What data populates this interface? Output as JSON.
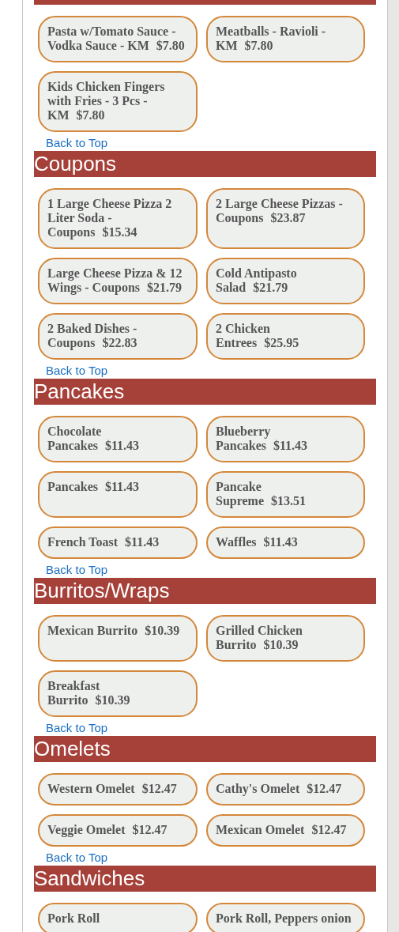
{
  "sections": [
    {
      "items": [
        {
          "name": "Pasta w/Tomato Sauce - Vodka Sauce - KM",
          "price": "$7.80"
        },
        {
          "name": "Meatballs - Ravioli - KM",
          "price": "$7.80"
        },
        {
          "name": "Kids Chicken Fingers with Fries - 3 Pcs - KM",
          "price": "$7.80"
        }
      ],
      "back_link": "Back to Top"
    },
    {
      "title": "Coupons",
      "items": [
        {
          "name": "1 Large Cheese Pizza 2 Liter Soda - Coupons",
          "price": "$15.34"
        },
        {
          "name": "2 Large Cheese Pizzas - Coupons",
          "price": "$23.87"
        },
        {
          "name": "Large Cheese Pizza & 12 Wings - Coupons",
          "price": "$21.79"
        },
        {
          "name": "Cold Antipasto Salad",
          "price": "$21.79"
        },
        {
          "name": "2 Baked Dishes - Coupons",
          "price": "$22.83"
        },
        {
          "name": "2 Chicken Entrees",
          "price": "$25.95"
        }
      ],
      "back_link": "Back to Top"
    },
    {
      "title": "Pancakes",
      "items": [
        {
          "name": "Chocolate Pancakes",
          "price": "$11.43"
        },
        {
          "name": "Blueberry Pancakes",
          "price": "$11.43"
        },
        {
          "name": "Pancakes",
          "price": "$11.43"
        },
        {
          "name": "Pancake Supreme",
          "price": "$13.51"
        },
        {
          "name": "French Toast",
          "price": "$11.43"
        },
        {
          "name": "Waffles",
          "price": "$11.43"
        }
      ],
      "back_link": "Back to Top"
    },
    {
      "title": "Burritos/Wraps",
      "items": [
        {
          "name": "Mexican Burrito",
          "price": "$10.39"
        },
        {
          "name": "Grilled Chicken Burrito",
          "price": "$10.39"
        },
        {
          "name": "Breakfast Burrito",
          "price": "$10.39"
        }
      ],
      "back_link": "Back to Top"
    },
    {
      "title": "Omelets",
      "items": [
        {
          "name": "Western Omelet",
          "price": "$12.47"
        },
        {
          "name": "Cathy's Omelet",
          "price": "$12.47"
        },
        {
          "name": "Veggie Omelet",
          "price": "$12.47"
        },
        {
          "name": "Mexican Omelet",
          "price": "$12.47"
        }
      ],
      "back_link": "Back to Top"
    },
    {
      "title": "Sandwiches",
      "items": [
        {
          "name": "Pork Roll"
        },
        {
          "name": "Pork Roll, Peppers onion"
        }
      ]
    }
  ]
}
